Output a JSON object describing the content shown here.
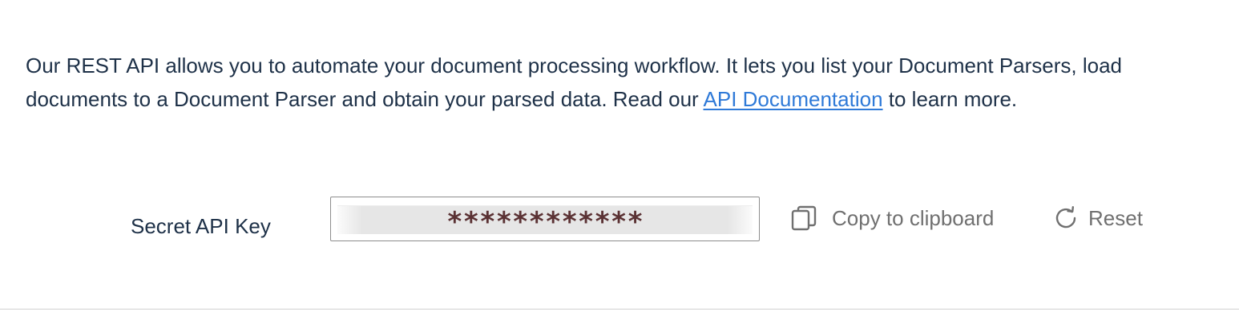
{
  "intro": {
    "text_before_link": "Our REST API allows you to automate your document processing workflow. It lets you list your Document Parsers, load documents to a Document Parser and obtain your parsed data. Read our ",
    "link_label": "API Documentation",
    "text_after_link": " to learn more."
  },
  "api_key": {
    "label": "Secret API Key",
    "masked_value": "************"
  },
  "actions": {
    "copy_label": "Copy to clipboard",
    "copy_icon": "copy-icon",
    "reset_label": "Reset",
    "reset_icon": "refresh-icon"
  },
  "colors": {
    "text": "#1e3148",
    "link": "#2f7ad8",
    "action_text": "#707070",
    "masked_key": "#5b3234"
  }
}
